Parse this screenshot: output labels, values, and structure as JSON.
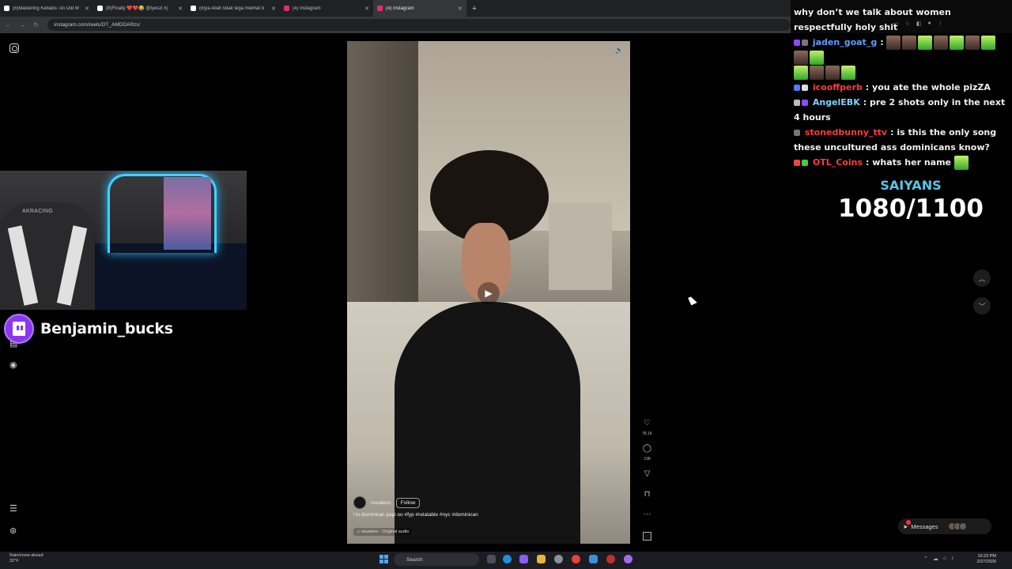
{
  "browser": {
    "tabs": [
      {
        "title": "(8)Mastering Kebabs: An Old M",
        "favicon_color": "#ffffff"
      },
      {
        "title": "(8)Finally ❤️❤️😂 @lyeszi #j",
        "favicon_color": "#ffffff"
      },
      {
        "title": "(8)ya Allah tidak tega melihat b",
        "favicon_color": "#ffffff"
      },
      {
        "title": "(4) Instagram",
        "favicon_color": "#e1306c"
      },
      {
        "title": "(4) Instagram",
        "favicon_color": "#e1306c",
        "active": true
      }
    ],
    "new_tab": "+",
    "url": "instagram.com/reels/DT_AMDDARzs/",
    "nav": {
      "back": "←",
      "forward": "→",
      "reload": "↻",
      "site_info": "⚙"
    }
  },
  "instagram": {
    "side_icons": [
      "instagram-logo",
      "menu-icon",
      "threads-icon"
    ],
    "reel": {
      "author": "nsualexx",
      "follow_label": "Follow",
      "caption": "i'm dominican papi oo #fyp #relatable #nyc #dominican",
      "audio": "♫ nsualexx · Original audio",
      "likes": "78.1K",
      "comments": "198",
      "more": "···"
    }
  },
  "stream": {
    "streamer_name": "Benjamin_bucks",
    "webcam_brand": "AKRACING",
    "goal_label": "SAIYANS",
    "goal_count": "1080/1100"
  },
  "chat": [
    {
      "user": "",
      "user_color": "#f0f0f0",
      "text": "why don’t we talk about women respectfully holy shit",
      "emotes": 0
    },
    {
      "user": "jaden_goat_g",
      "user_color": "#5aa0ff",
      "text": "",
      "emotes": 10
    },
    {
      "user": "icooffperb",
      "user_color": "#ff3b3b",
      "text": "you ate the whole pizZA",
      "emotes": 0
    },
    {
      "user": "AngelEBK",
      "user_color": "#7fd3ff",
      "text": "pre 2 shots only in the next 4 hours",
      "emotes": 0
    },
    {
      "user": "stonedbunny_ttv",
      "user_color": "#ff3b3b",
      "text": "is this the only song these uncultured ass dominicans know?",
      "emotes": 0
    },
    {
      "user": "OTL_Coins",
      "user_color": "#ff3b3b",
      "text": "whats her name",
      "emotes": 1
    }
  ],
  "messages": {
    "label": "Messages"
  },
  "taskbar": {
    "weather": [
      "Rain/snow ahead",
      "32°F"
    ],
    "search_placeholder": "Search",
    "clock": [
      "10:23 PM",
      "2/27/2026"
    ]
  }
}
